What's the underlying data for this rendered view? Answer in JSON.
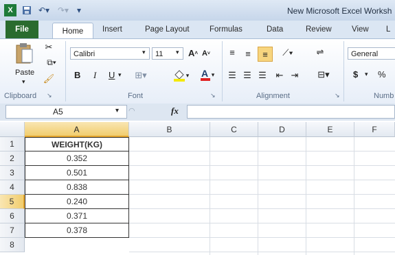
{
  "window": {
    "title": "New Microsoft Excel Worksh"
  },
  "quick_access": {
    "save_icon": "save-icon",
    "undo_icon": "undo-icon",
    "redo_icon": "redo-icon",
    "app_icon": "excel-icon"
  },
  "tabs": [
    "File",
    "Home",
    "Insert",
    "Page Layout",
    "Formulas",
    "Data",
    "Review",
    "View",
    "L"
  ],
  "ribbon": {
    "clipboard": {
      "paste_label": "Paste",
      "group_label": "Clipboard"
    },
    "font": {
      "font_name": "Calibri",
      "font_size": "11",
      "bold": "B",
      "italic": "I",
      "underline": "U",
      "group_label": "Font"
    },
    "alignment": {
      "group_label": "Alignment"
    },
    "number": {
      "format": "General",
      "currency": "$",
      "percent": "%",
      "group_label": "Numb"
    }
  },
  "formula_bar": {
    "name_box": "A5",
    "fx": "fx",
    "formula_value": ""
  },
  "columns": [
    "A",
    "B",
    "C",
    "D",
    "E",
    "F"
  ],
  "selected_column": "A",
  "rows": [
    "1",
    "2",
    "3",
    "4",
    "5",
    "6",
    "7",
    "8"
  ],
  "selected_row": "5",
  "cells": [
    {
      "row": "1",
      "value": "WEIGHT(KG)"
    },
    {
      "row": "2",
      "value": "0.352"
    },
    {
      "row": "3",
      "value": "0.501"
    },
    {
      "row": "4",
      "value": "0.838"
    },
    {
      "row": "5",
      "value": "0.240"
    },
    {
      "row": "6",
      "value": "0.371"
    },
    {
      "row": "7",
      "value": "0.378"
    }
  ],
  "colors": {
    "file_tab": "#2a6b2e",
    "selection_header": "#f1cd6e"
  }
}
